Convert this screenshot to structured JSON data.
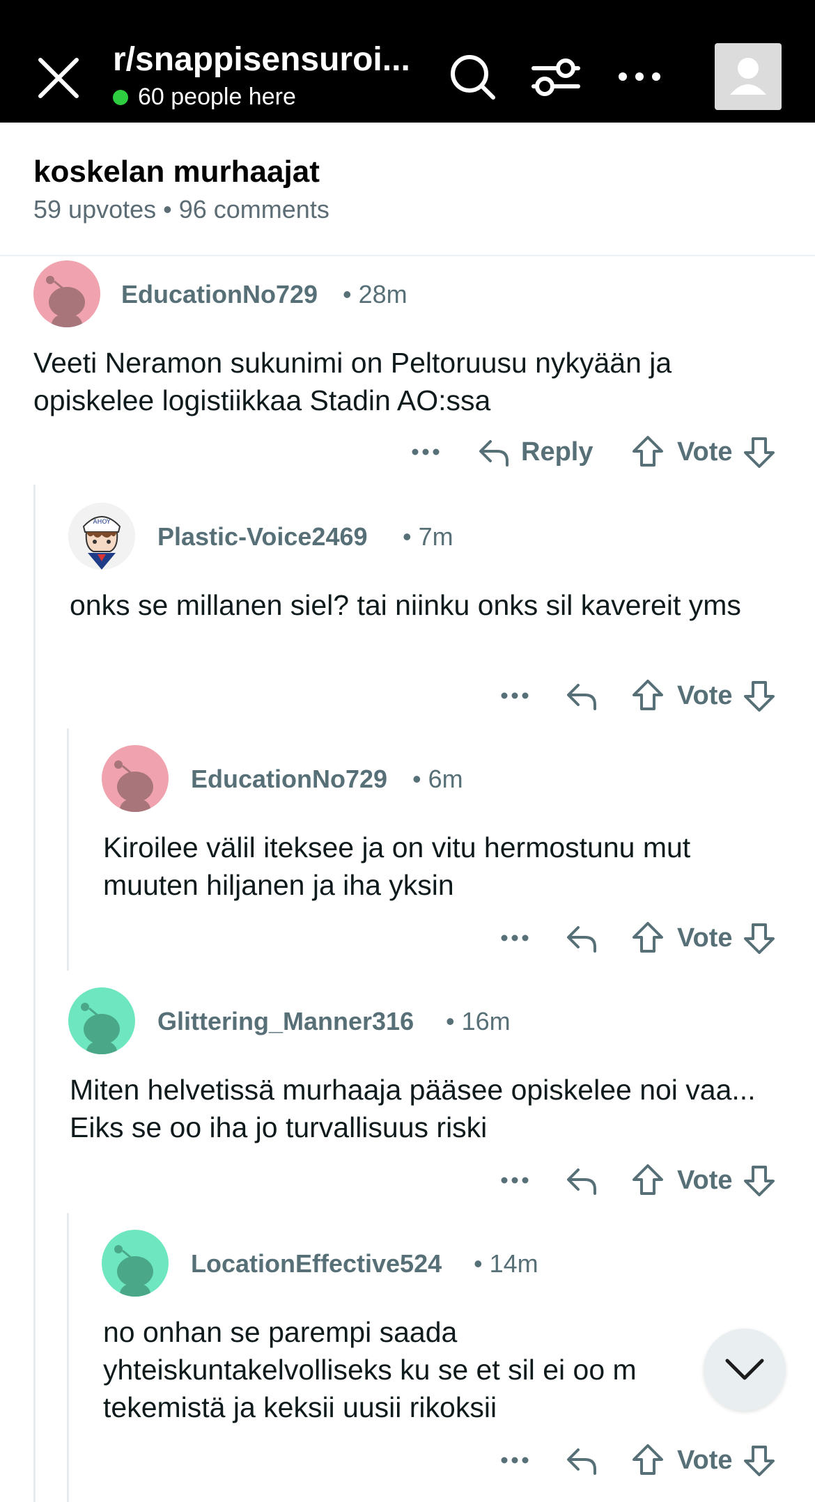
{
  "header": {
    "subreddit": "r/snappisensuroi...",
    "online_count": "60 people here",
    "online_color": "#2ecc40",
    "icons": [
      "close-icon",
      "search-icon",
      "filter-icon",
      "more-icon",
      "profile-avatar-icon"
    ]
  },
  "post": {
    "title": "koskelan murhaajat",
    "meta": "59 upvotes • 96 comments"
  },
  "actions": {
    "reply_label": "Reply",
    "vote_label": "Vote",
    "more": "•••"
  },
  "comments": [
    {
      "user": "EducationNo729",
      "time": "• 28m",
      "body": "Veeti Neramon sukunimi on  Peltoruusu nykyään ja opiskelee logistiikkaa Stadin AO:ssa",
      "avatar_color": "#f0a3ae"
    },
    {
      "user": "Plastic-Voice2469",
      "time": "• 7m",
      "body": "onks se millanen siel? tai niinku onks sil kavereit yms",
      "avatar_color": "#f2f2f2"
    },
    {
      "user": "EducationNo729",
      "time": "• 6m",
      "body": "Kiroilee välil iteksee ja on vitu hermostunu mut muuten hiljanen ja iha yksin",
      "avatar_color": "#f0a3ae"
    },
    {
      "user": "Glittering_Manner316",
      "time": "• 16m",
      "body": "Miten helvetissä murhaaja pääsee opiskelee noi vaa... Eiks se oo iha jo turvallisuus riski",
      "avatar_color": "#6ee7c0"
    },
    {
      "user": "LocationEffective524",
      "time": "• 14m",
      "body": "no onhan se parempi saada yhteiskuntakelvolliseks ku se et sil ei oo m tekemistä ja keksii uusii rikoksii",
      "avatar_color": "#6ee7c0"
    }
  ]
}
